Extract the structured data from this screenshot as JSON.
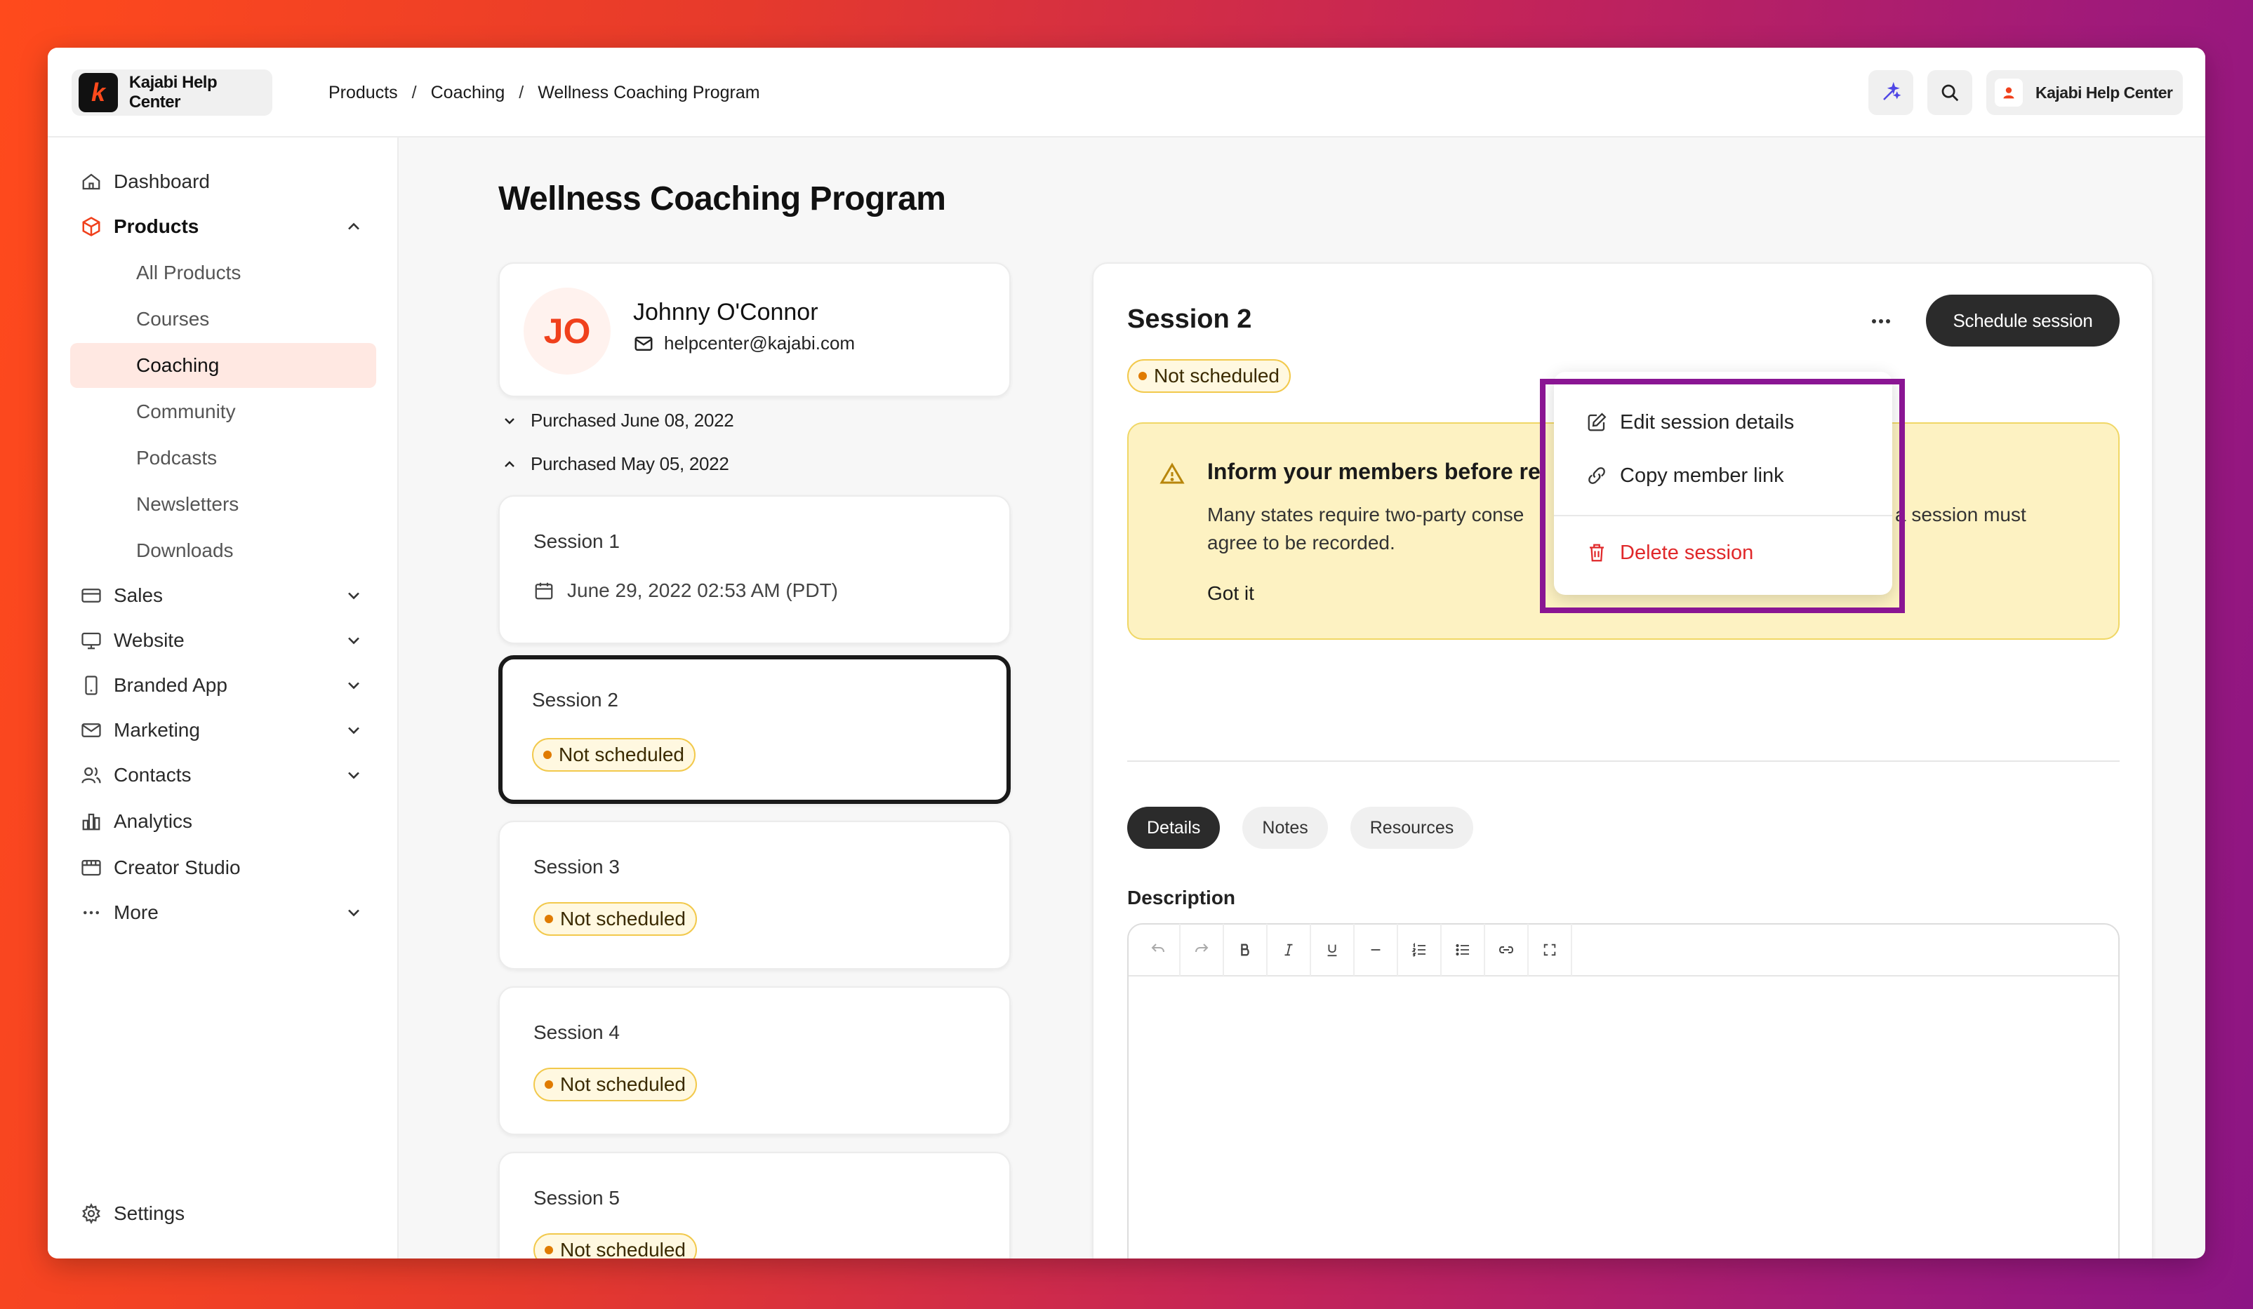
{
  "app": {
    "brand_name": "Kajabi Help Center",
    "account_name": "Kajabi Help Center"
  },
  "breadcrumb": {
    "items": [
      "Products",
      "Coaching",
      "Wellness Coaching Program"
    ],
    "sep": "/"
  },
  "sidebar": {
    "items": [
      {
        "label": "Dashboard"
      },
      {
        "label": "Products"
      },
      {
        "label": "Sales"
      },
      {
        "label": "Website"
      },
      {
        "label": "Branded App"
      },
      {
        "label": "Marketing"
      },
      {
        "label": "Contacts"
      },
      {
        "label": "Analytics"
      },
      {
        "label": "Creator Studio"
      },
      {
        "label": "More"
      }
    ],
    "subitems": [
      "All Products",
      "Courses",
      "Coaching",
      "Community",
      "Podcasts",
      "Newsletters",
      "Downloads"
    ],
    "settings": "Settings"
  },
  "page": {
    "title": "Wellness Coaching Program"
  },
  "member": {
    "initials": "JO",
    "name": "Johnny O'Connor",
    "email": "helpcenter@kajabi.com"
  },
  "purchases": [
    "Purchased June 08, 2022",
    "Purchased May 05, 2022"
  ],
  "sessions": [
    {
      "title": "Session 1",
      "date": "June 29, 2022 02:53 AM (PDT)"
    },
    {
      "title": "Session 2",
      "status": "Not scheduled"
    },
    {
      "title": "Session 3",
      "status": "Not scheduled"
    },
    {
      "title": "Session 4",
      "status": "Not scheduled"
    },
    {
      "title": "Session 5",
      "status": "Not scheduled"
    }
  ],
  "detail": {
    "title": "Session 2",
    "status": "Not scheduled",
    "schedule_button": "Schedule session",
    "alert": {
      "title": "Inform your members before re",
      "body_left": "Many states require two-party conse",
      "body_right": "a session must",
      "body_line2": "agree to be recorded.",
      "action": "Got it"
    },
    "tabs": [
      "Details",
      "Notes",
      "Resources"
    ],
    "description_label": "Description"
  },
  "menu": {
    "items": [
      "Edit session details",
      "Copy member link",
      "Delete session"
    ]
  },
  "colors": {
    "accent": "#f0401c",
    "highlight": "#8a1593",
    "danger": "#e0282a",
    "badge_border": "#f2c94c"
  }
}
